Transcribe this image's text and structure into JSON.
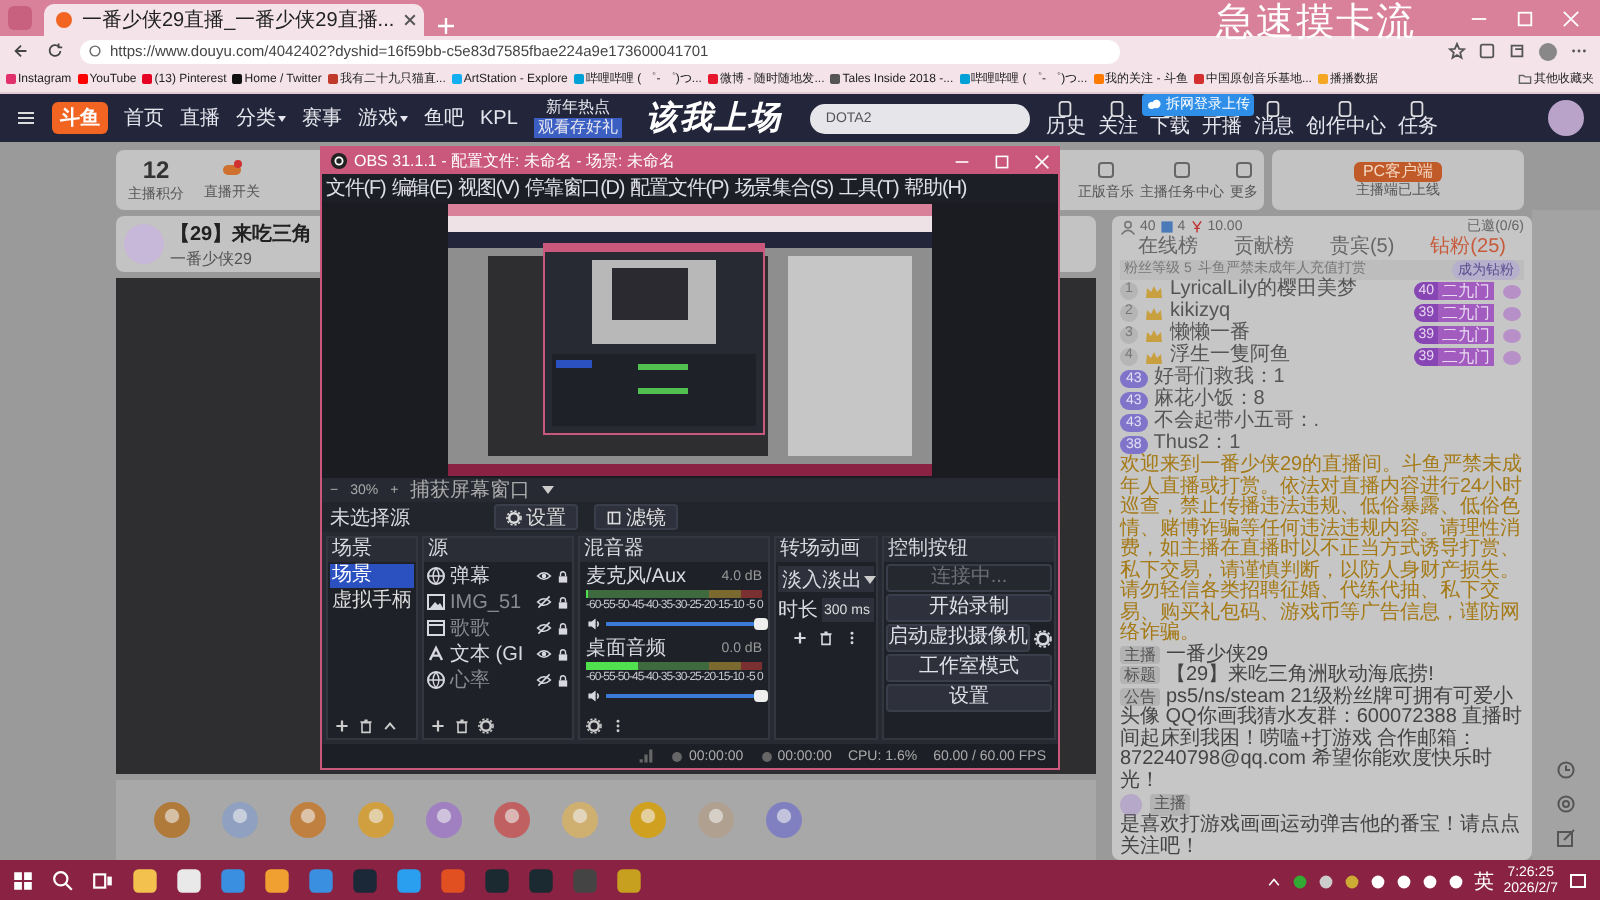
{
  "browser": {
    "tab_title": "一番少侠29直播_一番少侠29直播...",
    "overlay_caption": "急速摸卡流",
    "url": "https://www.douyu.com/4042402?dyshid=16f59bb-c5e83d7585fbae224a9e173600041701",
    "bookmarks": [
      {
        "label": "Instagram",
        "color": "#e1306c"
      },
      {
        "label": "YouTube",
        "color": "#ff0000"
      },
      {
        "label": "(13) Pinterest",
        "color": "#e60023"
      },
      {
        "label": "Home / Twitter",
        "color": "#111111"
      },
      {
        "label": "我有二十九只猫直...",
        "color": "#c0392b"
      },
      {
        "label": "ArtStation - Explore",
        "color": "#13aff0"
      },
      {
        "label": "哔哩哔哩 ( ゜- ゜)つ...",
        "color": "#00a1d6"
      },
      {
        "label": "微博 - 随时随地发...",
        "color": "#e6162d"
      },
      {
        "label": "Tales Inside 2018 -...",
        "color": "#555555"
      },
      {
        "label": "哔哩哔哩 ( ゜- ゜)つ...",
        "color": "#00a1d6"
      },
      {
        "label": "我的关注 - 斗鱼",
        "color": "#ff7a00"
      },
      {
        "label": "中国原创音乐基地...",
        "color": "#d32f2f"
      },
      {
        "label": "播播数据",
        "color": "#f5a623"
      }
    ],
    "other_bookmarks": "其他收藏夹"
  },
  "site_nav": {
    "logo_text": "斗鱼",
    "items": [
      {
        "label": "首页",
        "dropdown": false
      },
      {
        "label": "直播",
        "dropdown": false
      },
      {
        "label": "分类",
        "dropdown": true
      },
      {
        "label": "赛事",
        "dropdown": false
      },
      {
        "label": "游戏",
        "dropdown": true
      },
      {
        "label": "鱼吧",
        "dropdown": false
      },
      {
        "label": "KPL",
        "dropdown": false
      }
    ],
    "promo": {
      "title": "新年热点",
      "subtitle": "观看存好礼"
    },
    "banner": "该我上场",
    "search": {
      "value": "DOTA2"
    },
    "icons": [
      {
        "label": "历史"
      },
      {
        "label": "关注"
      },
      {
        "label": "下载"
      },
      {
        "label": "开播"
      },
      {
        "label": "消息"
      },
      {
        "label": "创作中心"
      },
      {
        "label": "任务"
      }
    ],
    "login_popup": "拆网登录上传"
  },
  "stats": {
    "score": {
      "value": "12",
      "label": "主播积分"
    },
    "items": [
      {
        "label": "直播开关"
      }
    ],
    "right_items": [
      {
        "label": "正版音乐"
      },
      {
        "label": "主播任务中心"
      },
      {
        "label": "更多"
      }
    ]
  },
  "client": {
    "button": "PC客户端",
    "note": "主播端已上线"
  },
  "stream": {
    "title": "【29】来吃三角",
    "anchor": "一番少侠29"
  },
  "chat": {
    "header": {
      "viewers": "40",
      "fans": "4",
      "money": "10.00",
      "invited": "已邀(0/6)"
    },
    "tabs": [
      {
        "label": "在线榜",
        "selected": false
      },
      {
        "label": "贡献榜",
        "selected": false
      },
      {
        "label": "贵宾(5)",
        "selected": false
      },
      {
        "label": "钻粉(25)",
        "selected": true
      }
    ],
    "fan_bar": {
      "level_label": "粉丝等级 5",
      "notice": "斗鱼严禁未成年人充值打赏",
      "button": "成为钻粉"
    },
    "rankers": [
      {
        "rank": "1",
        "name": "LyricalLily的樱田美梦",
        "badge": "40",
        "tag": "二九门"
      },
      {
        "rank": "2",
        "name": "kikizyq",
        "badge": "39",
        "tag": "二九门"
      },
      {
        "rank": "3",
        "name": "懒懒一番",
        "badge": "39",
        "tag": "二九门"
      },
      {
        "rank": "4",
        "name": "浮生一隻阿鱼",
        "badge": "39",
        "tag": "二九门"
      }
    ],
    "messages": [
      {
        "level": "43",
        "name": "好哥们救我",
        "text": "：1"
      },
      {
        "level": "43",
        "name": "麻花小饭",
        "text": "：8"
      },
      {
        "level": "43",
        "name": "不会起带小五哥",
        "text": "：."
      },
      {
        "level": "38",
        "name": "Thus2",
        "text": "：1"
      }
    ],
    "notice": "欢迎来到一番少侠29的直播间。斗鱼严禁未成年人直播或打赏。依法对直播内容进行24小时巡查，禁止传播违法违规、低俗暴露、低俗色情、赌博诈骗等任何违法违规内容。请理性消费，如主播在直播时以不正当方式诱导打赏、私下交易，请谨慎判断，以防人身财产损失。请勿轻信各类招聘征婚、代练代抽、私下交易、购买礼包码、游戏币等广告信息，谨防网络诈骗。",
    "info": [
      {
        "tag": "主播",
        "text": "一番少侠29"
      },
      {
        "tag": "标题",
        "text": "【29】来吃三角洲耿动海底捞!"
      },
      {
        "tag": "公告",
        "text": "ps5/ns/steam 21级粉丝牌可拥有可爱小头像 QQ你画我猜水友群：600072388 直播时间起床到我困！唠嗑+打游戏 合作邮箱：872240798@qq.com 希望你能欢度快乐时光！"
      }
    ],
    "host_message": {
      "tag": "主播",
      "text": "是喜欢打游戏画画运动弹吉他的番宝！请点点关注吧！"
    }
  },
  "obs": {
    "title": "OBS 31.1.1 - 配置文件: 未命名 - 场景: 未命名",
    "menu": [
      "文件(F)",
      "编辑(E)",
      "视图(V)",
      "停靠窗口(D)",
      "配置文件(P)",
      "场景集合(S)",
      "工具(T)",
      "帮助(H)"
    ],
    "zoom_out": "−",
    "zoom": "30%",
    "zoom_in": "+",
    "capture": "捕获屏幕窗口",
    "source_status": "未选择源",
    "source_buttons": [
      "设置",
      "滤镜"
    ],
    "scenes": {
      "title": "场景",
      "items": [
        {
          "label": "场景",
          "selected": true
        },
        {
          "label": "虚拟手柄",
          "selected": false
        }
      ]
    },
    "sources": {
      "title": "源",
      "items": [
        {
          "kind": "browser",
          "label": "弹幕",
          "visible": true
        },
        {
          "kind": "image",
          "label": "IMG_51",
          "visible": false
        },
        {
          "kind": "window",
          "label": "歌歌",
          "visible": false
        },
        {
          "kind": "text",
          "label": "文本 (GI",
          "visible": true
        },
        {
          "kind": "browser",
          "label": "心率",
          "visible": false
        }
      ]
    },
    "mixer": {
      "title": "混音器",
      "channels": [
        {
          "name": "麦克风/Aux",
          "reading": "4.0 dB",
          "scale": "-60-55-50-45-40-35-30-25-20-15-10 -5 0",
          "meter": {
            "level": 0
          },
          "fader": {
            "level": 1
          }
        },
        {
          "name": "桌面音频",
          "reading": "0.0 dB",
          "scale": "-60-55-50-45-40-35-30-25-20-15-10 -5 0",
          "meter": {
            "level": 0.3
          },
          "fader": {
            "level": 1
          }
        }
      ]
    },
    "transitions": {
      "title": "转场动画",
      "transition": "淡入淡出",
      "duration_label": "时长",
      "duration": "300 ms"
    },
    "controls": {
      "title": "控制按钮",
      "buttons": [
        {
          "label": "连接中...",
          "disabled": true
        },
        {
          "label": "开始录制",
          "disabled": false
        },
        {
          "label": "启动虚拟摄像机",
          "disabled": false
        },
        {
          "label": "工作室模式",
          "disabled": false
        },
        {
          "label": "设置",
          "disabled": false
        }
      ]
    },
    "status": {
      "stream_time": "00:00:00",
      "record_time": "00:00:00",
      "cpu": "CPU: 1.6%",
      "fps": "60.00 / 60.00 FPS"
    }
  },
  "taskbar": {
    "time": "7:26:25",
    "date": "2026/2/7",
    "ime": "英"
  }
}
